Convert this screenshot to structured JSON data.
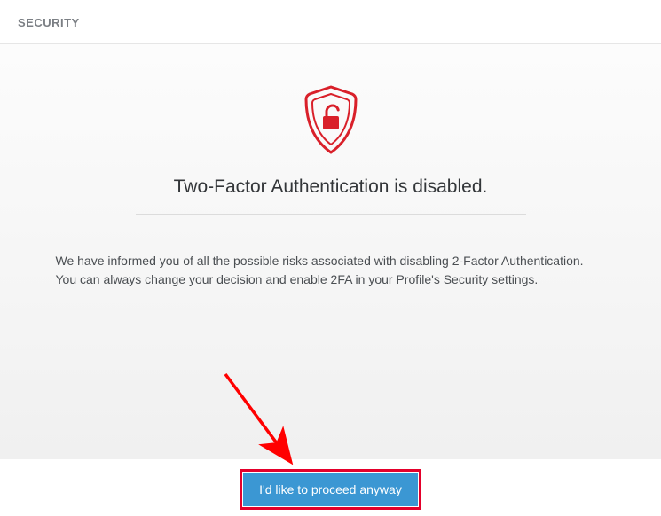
{
  "header": {
    "title": "SECURITY"
  },
  "main": {
    "status_title": "Two-Factor Authentication is disabled.",
    "body_line1": "We have informed you of all the possible risks associated with disabling 2-Factor Authentication.",
    "body_line2": "You can always change your decision and enable 2FA in your Profile's Security settings."
  },
  "footer": {
    "proceed_label": "I'd like to proceed anyway"
  },
  "colors": {
    "accent_red": "#d9202a",
    "button_blue": "#3b97d3",
    "highlight_red": "#e4002b"
  }
}
